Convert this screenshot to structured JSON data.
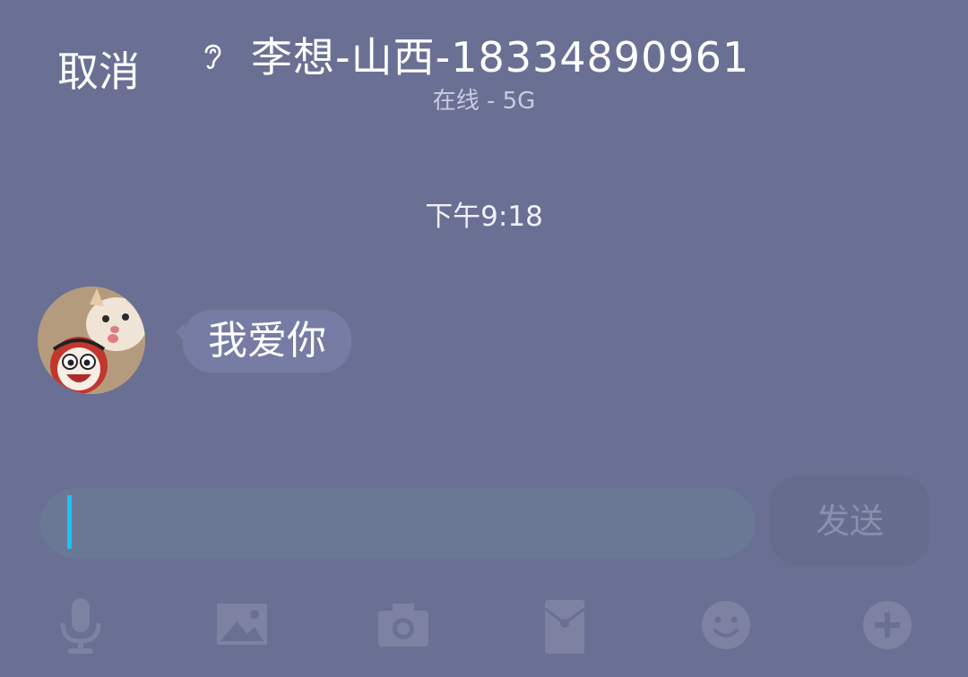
{
  "header": {
    "cancel_label": "取消",
    "title": "李想-山西-18334890961",
    "status": "在线 - 5G",
    "ear_icon": "ear-icon"
  },
  "chat": {
    "timestamp": "下午9:18",
    "messages": [
      {
        "sender": "contact",
        "text": "我爱你"
      }
    ]
  },
  "composer": {
    "input_value": "",
    "send_label": "发送"
  },
  "toolbar": {
    "icons": [
      "microphone-icon",
      "image-icon",
      "camera-icon",
      "red-envelope-icon",
      "emoji-icon",
      "plus-icon"
    ]
  },
  "colors": {
    "background": "#6a6f94",
    "bubble": "#767ca3",
    "input": "#6a7896",
    "caret": "#19c3f4",
    "send_button": "#666c8e",
    "toolbar_icon": "#7d82a3"
  }
}
